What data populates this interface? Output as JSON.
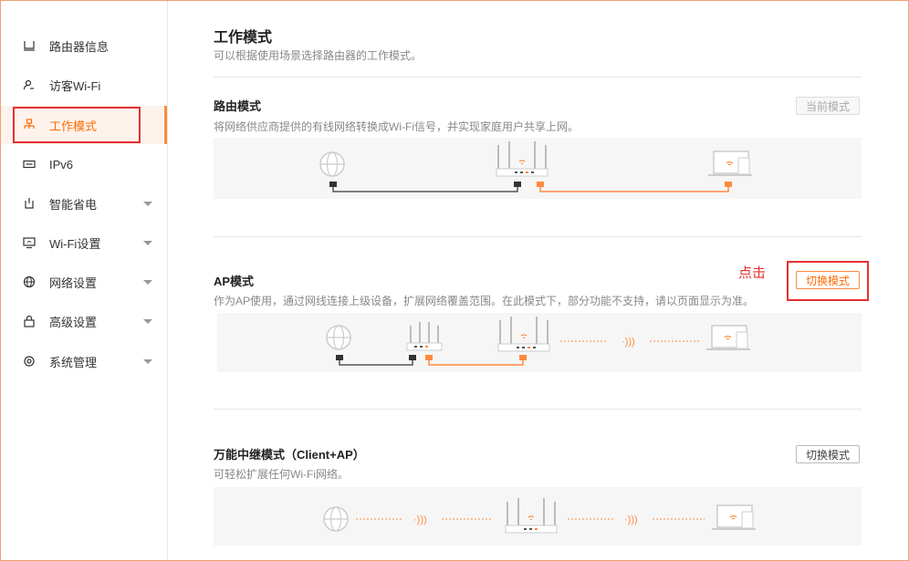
{
  "sidebar": {
    "items": [
      {
        "label": "路由器信息",
        "icon": "router-icon",
        "expandable": false
      },
      {
        "label": "访客Wi-Fi",
        "icon": "guest-user-icon",
        "expandable": false
      },
      {
        "label": "工作模式",
        "icon": "network-topology-icon",
        "expandable": false,
        "active": true
      },
      {
        "label": "IPv6",
        "icon": "ipv6-icon",
        "expandable": false
      },
      {
        "label": "智能省电",
        "icon": "power-save-icon",
        "expandable": true
      },
      {
        "label": "Wi-Fi设置",
        "icon": "wifi-settings-icon",
        "expandable": true
      },
      {
        "label": "网络设置",
        "icon": "globe-icon",
        "expandable": true
      },
      {
        "label": "高级设置",
        "icon": "lock-icon",
        "expandable": true
      },
      {
        "label": "系统管理",
        "icon": "gear-icon",
        "expandable": true
      }
    ]
  },
  "page": {
    "title": "工作模式",
    "subtitle": "可以根据使用场景选择路由器的工作模式。"
  },
  "modes": [
    {
      "title": "路由模式",
      "desc": "将网络供应商提供的有线网络转换成Wi-Fi信号，并实现家庭用户共享上网。",
      "button": "当前模式",
      "button_state": "disabled"
    },
    {
      "title": "AP模式",
      "desc": "作为AP使用，通过网线连接上级设备，扩展网络覆盖范围。在此模式下，部分功能不支持，请以页面显示为准。",
      "button": "切换模式",
      "button_state": "highlighted"
    },
    {
      "title": "万能中继模式（Client+AP）",
      "desc": "可轻松扩展任何Wi-Fi网络。",
      "button": "切换模式",
      "button_state": "normal"
    }
  ],
  "annotation": {
    "text": "点击"
  },
  "colors": {
    "accent": "#ff6a00",
    "highlight_red": "#e53030",
    "wire_dark": "#555555",
    "wire_orange": "#ff8a3d"
  }
}
